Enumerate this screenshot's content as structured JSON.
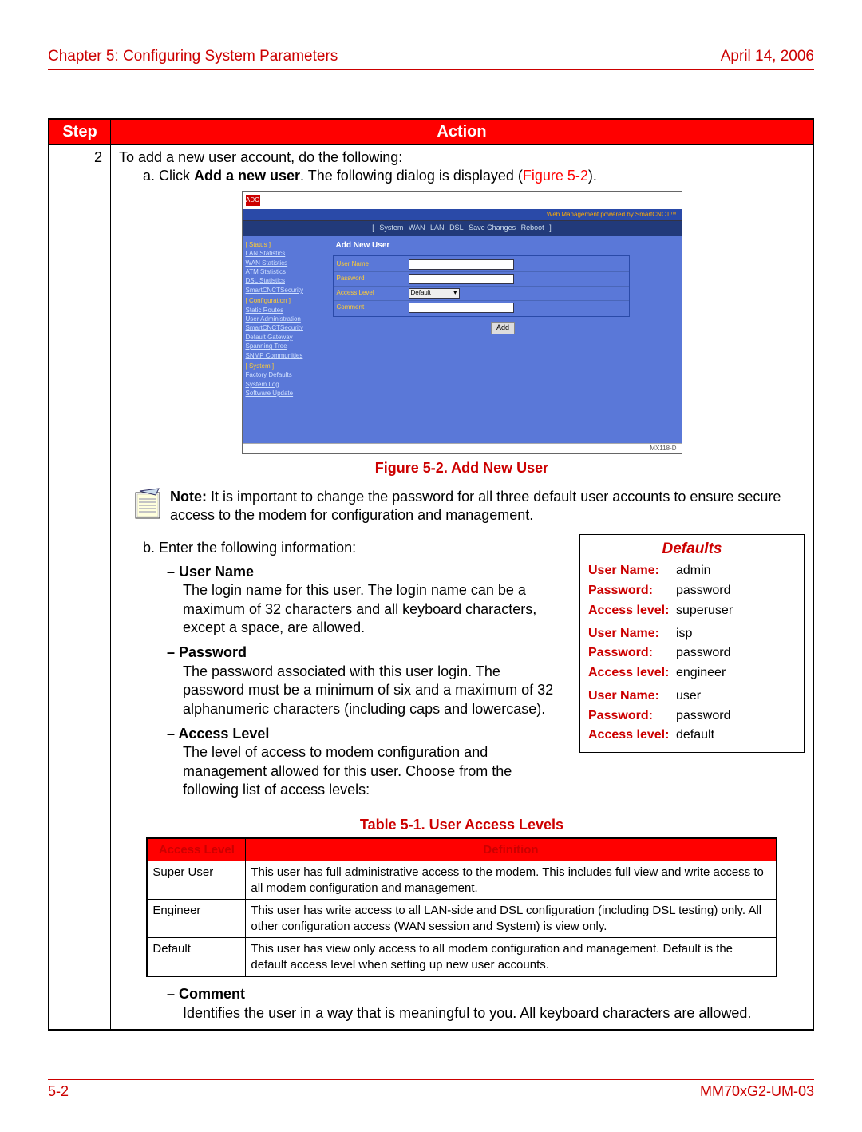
{
  "header": {
    "chapter": "Chapter 5: Configuring System Parameters",
    "date": "April 14, 2006"
  },
  "table_headers": {
    "step": "Step",
    "action": "Action"
  },
  "step_num": "2",
  "intro_line": "To add a new user account, do the following:",
  "step_a_prefix": "a. Click ",
  "step_a_bold": "Add a new user",
  "step_a_suffix1": ". The following dialog is displayed (",
  "step_a_link": "Figure 5-2",
  "step_a_suffix2": ").",
  "figure_caption": "Figure 5-2. Add New User",
  "note_label": "Note:",
  "note_text": " It is important to change the password for all three default user accounts to ensure secure access to the modem for configuration and management.",
  "step_b": "b. Enter the following information:",
  "defaults": {
    "title": "Defaults",
    "labels": {
      "user": "User Name:",
      "pass": "Password:",
      "level": "Access level:"
    },
    "rows": [
      {
        "user": "admin",
        "pass": "password",
        "level": "superuser"
      },
      {
        "user": "isp",
        "pass": "password",
        "level": "engineer"
      },
      {
        "user": "user",
        "pass": "password",
        "level": "default"
      }
    ]
  },
  "fields": {
    "user_name": {
      "label": "User Name",
      "desc": "The login name for this user. The login name can be a maximum of 32 characters and all keyboard characters, except a space, are allowed."
    },
    "password": {
      "label": "Password",
      "desc": "The password associated with this user login. The password must be a minimum of six and a maximum of 32 alphanumeric characters (including caps and lowercase)."
    },
    "access_level": {
      "label": "Access Level",
      "desc": "The level of access to modem configuration and management allowed for this user. Choose from the following list of access levels:"
    },
    "comment": {
      "label": "Comment",
      "desc": "Identifies the user in a way that is meaningful to you. All keyboard characters are allowed."
    }
  },
  "access_table": {
    "caption": "Table 5-1. User Access Levels",
    "headers": {
      "level": "Access Level",
      "def": "Definition"
    },
    "rows": [
      {
        "level": "Super User",
        "def": "This user has full administrative access to the modem. This includes full view and write access to all modem configuration and management."
      },
      {
        "level": "Engineer",
        "def": "This user has write access to all LAN-side and DSL configuration (including DSL testing) only. All other configuration access (WAN session and System) is view only."
      },
      {
        "level": "Default",
        "def": "This user has view only access to all modem configuration and management. Default is the default access level when setting up new user accounts."
      }
    ]
  },
  "footer": {
    "page": "5-2",
    "doc": "MM70xG2-UM-03"
  },
  "figure": {
    "logo": "ADC",
    "powered": "Web Management powered by SmartCNCT™",
    "nav_bracket_l": "[",
    "nav_bracket_r": "]",
    "nav": [
      "System",
      "WAN",
      "LAN",
      "DSL",
      "Save Changes",
      "Reboot"
    ],
    "sidebar": {
      "sec_status": "[ Status ]",
      "links1": [
        "LAN Statistics",
        "WAN Statistics",
        "ATM Statistics",
        "DSL Statistics",
        "SmartCNCTSecurity"
      ],
      "sec_config": "[ Configuration ]",
      "links2": [
        "Static Routes",
        "User Administration",
        "SmartCNCTSecurity",
        "Default Gateway",
        "Spanning Tree",
        "SNMP Communities"
      ],
      "sec_system": "[ System ]",
      "links3": [
        "Factory Defaults",
        "System Log",
        "Software Update"
      ]
    },
    "form": {
      "title": "Add New User",
      "rows": {
        "user": "User Name",
        "pass": "Password",
        "level": "Access Level",
        "level_val": "Default",
        "comment": "Comment"
      },
      "add": "Add"
    },
    "model": "MX118-D"
  }
}
